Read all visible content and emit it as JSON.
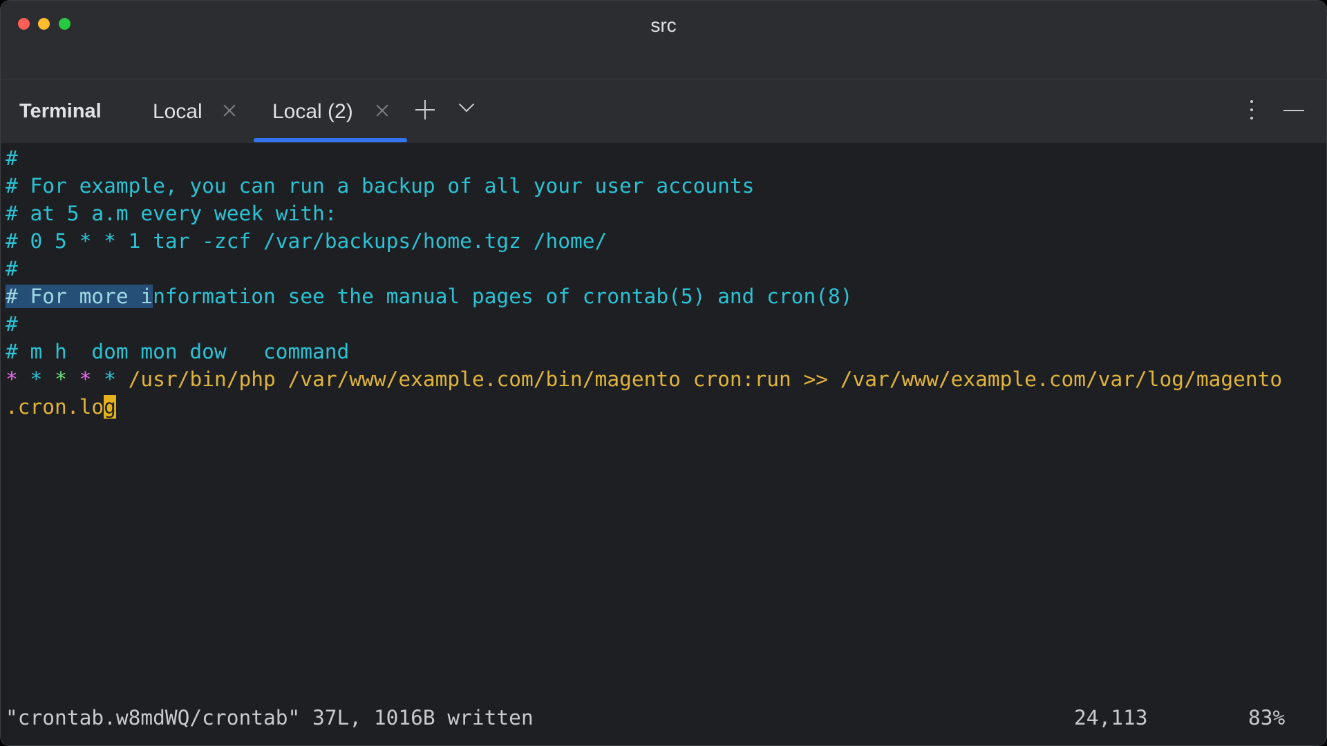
{
  "window": {
    "title": "src"
  },
  "tabbar": {
    "tool_title": "Terminal",
    "tabs": [
      {
        "label": "Local",
        "active": false
      },
      {
        "label": "Local (2)",
        "active": true
      }
    ]
  },
  "terminal": {
    "lines": {
      "l1": "#",
      "l2": "# For example, you can run a backup of all your user accounts",
      "l3": "# at 5 a.m every week with:",
      "l4": "# 0 5 * * 1 tar -zcf /var/backups/home.tgz /home/",
      "l5": "#",
      "l6_selected": "# For more i",
      "l6_rest": "nformation see the manual pages of crontab(5) and cron(8)",
      "l7": "#",
      "l8": "# m h  dom mon dow   command",
      "l9_star1": "*",
      "l9_star2": "*",
      "l9_star3": "*",
      "l9_star4": "*",
      "l9_star5": "*",
      "l9_rest": "/usr/bin/php /var/www/example.com/bin/magento cron:run >> /var/www/example.com/var/log/magento",
      "l10_pre": ".cron.lo",
      "l10_cursor": "g"
    },
    "status": {
      "message": "\"crontab.w8mdWQ/crontab\" 37L, 1016B written",
      "position": "24,113",
      "percent": "83%"
    },
    "colors": {
      "comment": "#2bc2d4",
      "command": "#e0b43c",
      "cursor": "#e3b21c",
      "selection": "#264f78",
      "active_tab_underline": "#3574f0"
    }
  }
}
